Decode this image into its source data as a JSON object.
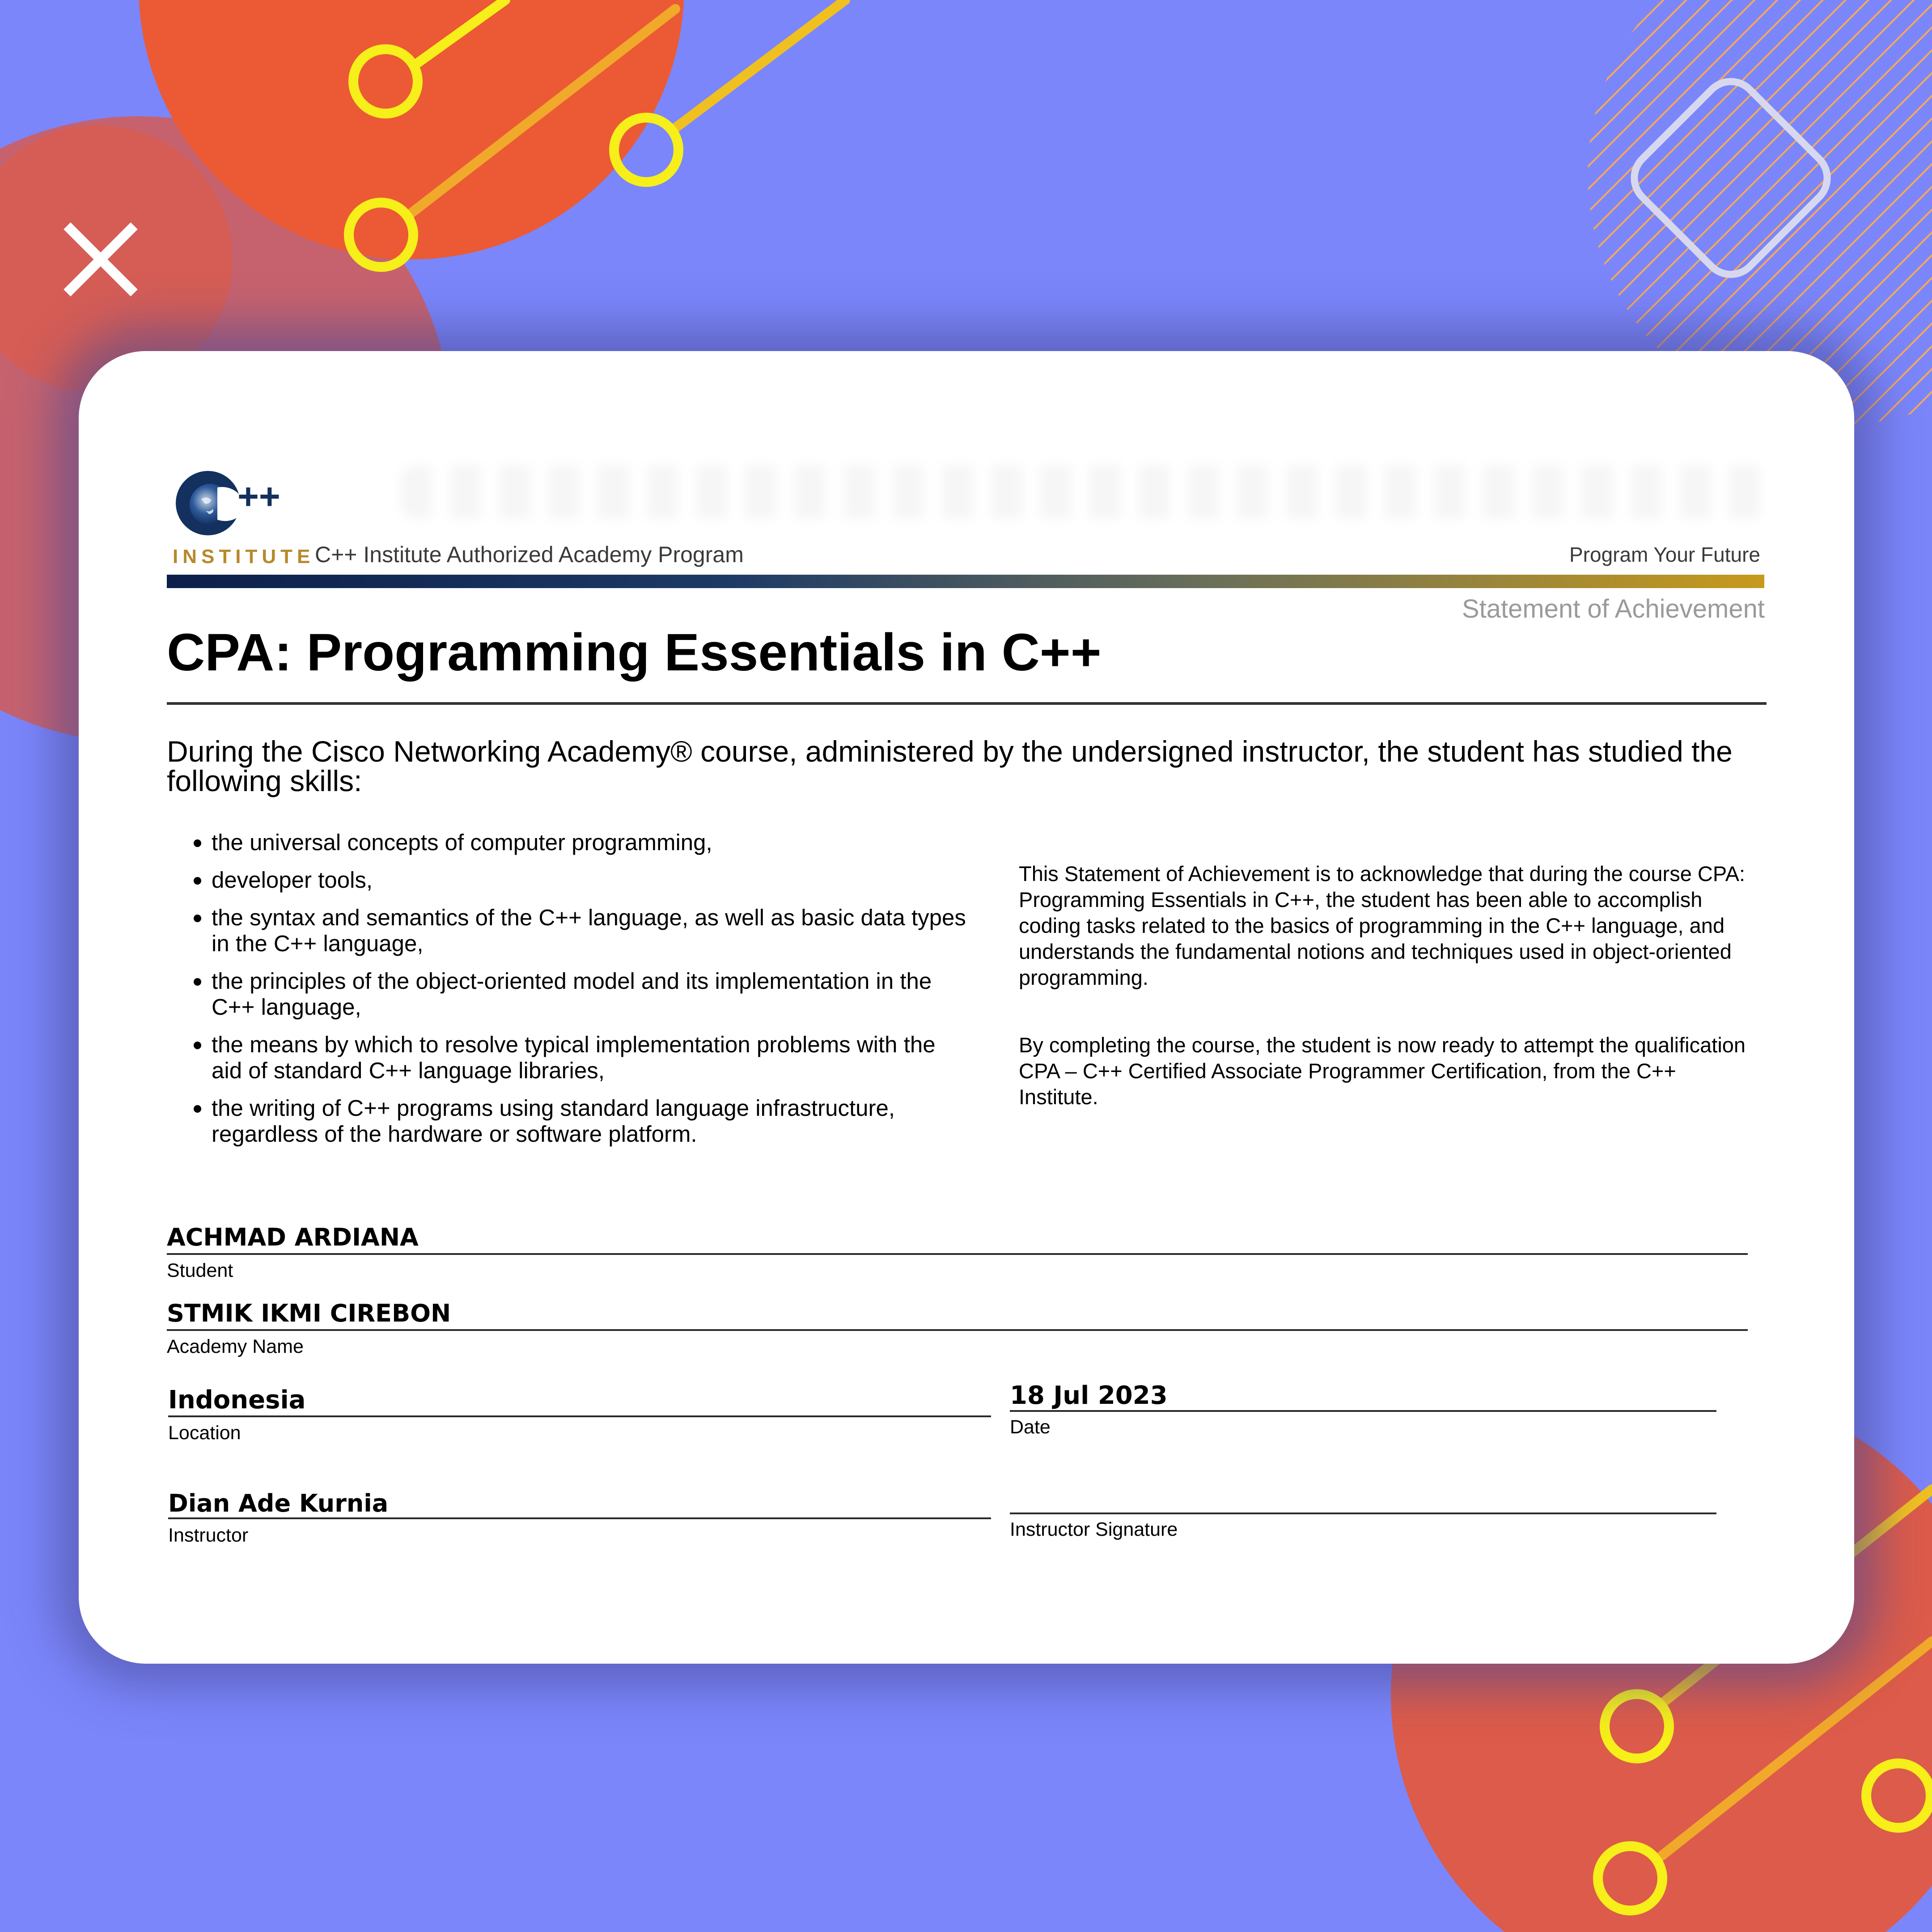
{
  "logo": {
    "mark": "++",
    "sub_label": "INSTITUTE",
    "icon": "globe-c-logo"
  },
  "header": {
    "program": "C++ Institute Authorized Academy Program",
    "tagline": "Program Your Future",
    "document_type": "Statement of Achievement"
  },
  "course": {
    "title": "CPA: Programming Essentials in C++"
  },
  "intro": "During the Cisco Networking Academy® course, administered by the undersigned instructor, the student has studied the following skills:",
  "skills": [
    "the universal concepts of computer programming,",
    "developer tools,",
    "the syntax and semantics of the C++ language, as well as basic data types in the C++ language,",
    "the principles of the object-oriented model and its implementation in the C++ language,",
    "the means by which to resolve typical implementation problems with the aid of standard C++ language libraries,",
    "the writing of C++ programs using standard language infrastructure, regardless of the hardware or software platform."
  ],
  "statement": [
    "This Statement of Achievement is to acknowledge that during the course CPA: Programming Essentials in C++, the student has been able to accomplish coding tasks related to the basics of programming in the C++ language, and understands the fundamental notions and techniques used in object-oriented programming.",
    "By completing the course, the student is now ready to attempt the qualification CPA – C++ Certified Associate Programmer Certification, from the C++ Institute."
  ],
  "fields": {
    "student": {
      "label": "Student",
      "value": "ACHMAD ARDIANA"
    },
    "academy": {
      "label": "Academy Name",
      "value": "STMIK IKMI CIREBON"
    },
    "location": {
      "label": "Location",
      "value": "Indonesia"
    },
    "date": {
      "label": "Date",
      "value": "18 Jul 2023"
    },
    "instructor": {
      "label": "Instructor",
      "value": "Dian Ade Kurnia"
    },
    "signature": {
      "label": "Instructor Signature",
      "value": ""
    }
  },
  "colors": {
    "background": "#7b86fb",
    "orange": "#f0572b",
    "coral": "#e05a45",
    "accent_yellow": "#f6ef1a",
    "logo_navy": "#13305e",
    "logo_gold": "#b7892b"
  }
}
